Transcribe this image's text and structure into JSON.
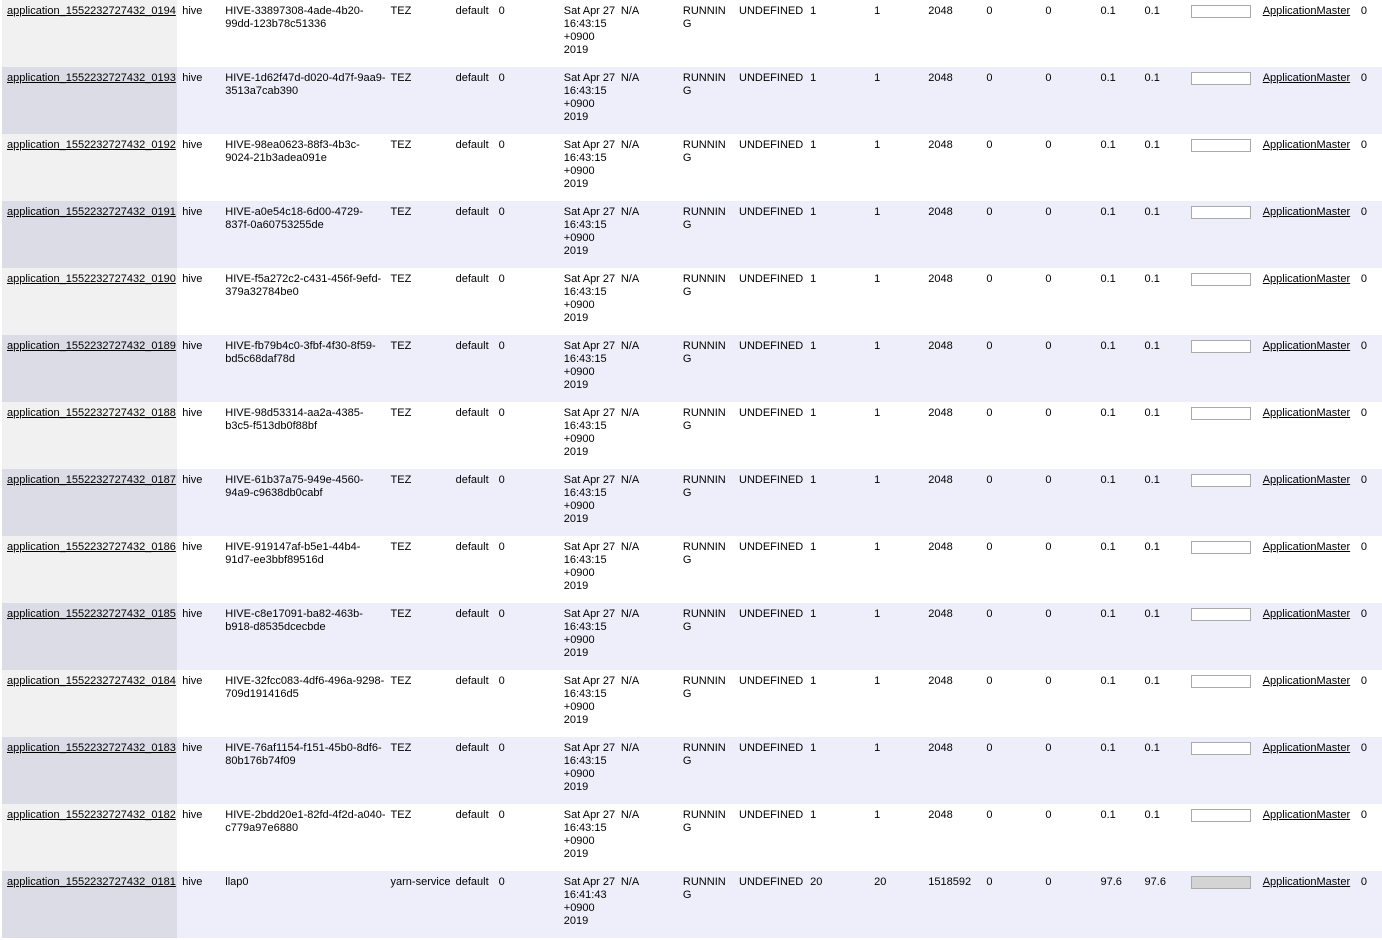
{
  "progress_colors": {
    "fill": "#d4d4d4",
    "border": "#aaaaaa"
  },
  "rows": [
    {
      "id": "application_1552232727432_0194",
      "user": "hive",
      "name": "HIVE-33897308-4ade-4b20-99dd-123b78c51336",
      "type": "TEZ",
      "queue": "default",
      "priority": "0",
      "start": "Sat Apr 27 16:43:15 +0900 2019",
      "finish": "N/A",
      "state": "RUNNING",
      "final_status": "UNDEFINED",
      "containers": "1",
      "vcores": "1",
      "memory": "2048",
      "reserved_cpu": "0",
      "reserved_mem": "0",
      "queue_pct": "0.1",
      "cluster_pct": "0.1",
      "progress": 0,
      "tracking": "ApplicationMaster",
      "blacklisted": "0"
    },
    {
      "id": "application_1552232727432_0193",
      "user": "hive",
      "name": "HIVE-1d62f47d-d020-4d7f-9aa9-3513a7cab390",
      "type": "TEZ",
      "queue": "default",
      "priority": "0",
      "start": "Sat Apr 27 16:43:15 +0900 2019",
      "finish": "N/A",
      "state": "RUNNING",
      "final_status": "UNDEFINED",
      "containers": "1",
      "vcores": "1",
      "memory": "2048",
      "reserved_cpu": "0",
      "reserved_mem": "0",
      "queue_pct": "0.1",
      "cluster_pct": "0.1",
      "progress": 0,
      "tracking": "ApplicationMaster",
      "blacklisted": "0"
    },
    {
      "id": "application_1552232727432_0192",
      "user": "hive",
      "name": "HIVE-98ea0623-88f3-4b3c-9024-21b3adea091e",
      "type": "TEZ",
      "queue": "default",
      "priority": "0",
      "start": "Sat Apr 27 16:43:15 +0900 2019",
      "finish": "N/A",
      "state": "RUNNING",
      "final_status": "UNDEFINED",
      "containers": "1",
      "vcores": "1",
      "memory": "2048",
      "reserved_cpu": "0",
      "reserved_mem": "0",
      "queue_pct": "0.1",
      "cluster_pct": "0.1",
      "progress": 0,
      "tracking": "ApplicationMaster",
      "blacklisted": "0"
    },
    {
      "id": "application_1552232727432_0191",
      "user": "hive",
      "name": "HIVE-a0e54c18-6d00-4729-837f-0a60753255de",
      "type": "TEZ",
      "queue": "default",
      "priority": "0",
      "start": "Sat Apr 27 16:43:15 +0900 2019",
      "finish": "N/A",
      "state": "RUNNING",
      "final_status": "UNDEFINED",
      "containers": "1",
      "vcores": "1",
      "memory": "2048",
      "reserved_cpu": "0",
      "reserved_mem": "0",
      "queue_pct": "0.1",
      "cluster_pct": "0.1",
      "progress": 0,
      "tracking": "ApplicationMaster",
      "blacklisted": "0"
    },
    {
      "id": "application_1552232727432_0190",
      "user": "hive",
      "name": "HIVE-f5a272c2-c431-456f-9efd-379a32784be0",
      "type": "TEZ",
      "queue": "default",
      "priority": "0",
      "start": "Sat Apr 27 16:43:15 +0900 2019",
      "finish": "N/A",
      "state": "RUNNING",
      "final_status": "UNDEFINED",
      "containers": "1",
      "vcores": "1",
      "memory": "2048",
      "reserved_cpu": "0",
      "reserved_mem": "0",
      "queue_pct": "0.1",
      "cluster_pct": "0.1",
      "progress": 0,
      "tracking": "ApplicationMaster",
      "blacklisted": "0"
    },
    {
      "id": "application_1552232727432_0189",
      "user": "hive",
      "name": "HIVE-fb79b4c0-3fbf-4f30-8f59-bd5c68daf78d",
      "type": "TEZ",
      "queue": "default",
      "priority": "0",
      "start": "Sat Apr 27 16:43:15 +0900 2019",
      "finish": "N/A",
      "state": "RUNNING",
      "final_status": "UNDEFINED",
      "containers": "1",
      "vcores": "1",
      "memory": "2048",
      "reserved_cpu": "0",
      "reserved_mem": "0",
      "queue_pct": "0.1",
      "cluster_pct": "0.1",
      "progress": 0,
      "tracking": "ApplicationMaster",
      "blacklisted": "0"
    },
    {
      "id": "application_1552232727432_0188",
      "user": "hive",
      "name": "HIVE-98d53314-aa2a-4385-b3c5-f513db0f88bf",
      "type": "TEZ",
      "queue": "default",
      "priority": "0",
      "start": "Sat Apr 27 16:43:15 +0900 2019",
      "finish": "N/A",
      "state": "RUNNING",
      "final_status": "UNDEFINED",
      "containers": "1",
      "vcores": "1",
      "memory": "2048",
      "reserved_cpu": "0",
      "reserved_mem": "0",
      "queue_pct": "0.1",
      "cluster_pct": "0.1",
      "progress": 0,
      "tracking": "ApplicationMaster",
      "blacklisted": "0"
    },
    {
      "id": "application_1552232727432_0187",
      "user": "hive",
      "name": "HIVE-61b37a75-949e-4560-94a9-c9638db0cabf",
      "type": "TEZ",
      "queue": "default",
      "priority": "0",
      "start": "Sat Apr 27 16:43:15 +0900 2019",
      "finish": "N/A",
      "state": "RUNNING",
      "final_status": "UNDEFINED",
      "containers": "1",
      "vcores": "1",
      "memory": "2048",
      "reserved_cpu": "0",
      "reserved_mem": "0",
      "queue_pct": "0.1",
      "cluster_pct": "0.1",
      "progress": 0,
      "tracking": "ApplicationMaster",
      "blacklisted": "0"
    },
    {
      "id": "application_1552232727432_0186",
      "user": "hive",
      "name": "HIVE-919147af-b5e1-44b4-91d7-ee3bbf89516d",
      "type": "TEZ",
      "queue": "default",
      "priority": "0",
      "start": "Sat Apr 27 16:43:15 +0900 2019",
      "finish": "N/A",
      "state": "RUNNING",
      "final_status": "UNDEFINED",
      "containers": "1",
      "vcores": "1",
      "memory": "2048",
      "reserved_cpu": "0",
      "reserved_mem": "0",
      "queue_pct": "0.1",
      "cluster_pct": "0.1",
      "progress": 0,
      "tracking": "ApplicationMaster",
      "blacklisted": "0"
    },
    {
      "id": "application_1552232727432_0185",
      "user": "hive",
      "name": "HIVE-c8e17091-ba82-463b-b918-d8535dcecbde",
      "type": "TEZ",
      "queue": "default",
      "priority": "0",
      "start": "Sat Apr 27 16:43:15 +0900 2019",
      "finish": "N/A",
      "state": "RUNNING",
      "final_status": "UNDEFINED",
      "containers": "1",
      "vcores": "1",
      "memory": "2048",
      "reserved_cpu": "0",
      "reserved_mem": "0",
      "queue_pct": "0.1",
      "cluster_pct": "0.1",
      "progress": 0,
      "tracking": "ApplicationMaster",
      "blacklisted": "0"
    },
    {
      "id": "application_1552232727432_0184",
      "user": "hive",
      "name": "HIVE-32fcc083-4df6-496a-9298-709d191416d5",
      "type": "TEZ",
      "queue": "default",
      "priority": "0",
      "start": "Sat Apr 27 16:43:15 +0900 2019",
      "finish": "N/A",
      "state": "RUNNING",
      "final_status": "UNDEFINED",
      "containers": "1",
      "vcores": "1",
      "memory": "2048",
      "reserved_cpu": "0",
      "reserved_mem": "0",
      "queue_pct": "0.1",
      "cluster_pct": "0.1",
      "progress": 0,
      "tracking": "ApplicationMaster",
      "blacklisted": "0"
    },
    {
      "id": "application_1552232727432_0183",
      "user": "hive",
      "name": "HIVE-76af1154-f151-45b0-8df6-80b176b74f09",
      "type": "TEZ",
      "queue": "default",
      "priority": "0",
      "start": "Sat Apr 27 16:43:15 +0900 2019",
      "finish": "N/A",
      "state": "RUNNING",
      "final_status": "UNDEFINED",
      "containers": "1",
      "vcores": "1",
      "memory": "2048",
      "reserved_cpu": "0",
      "reserved_mem": "0",
      "queue_pct": "0.1",
      "cluster_pct": "0.1",
      "progress": 0,
      "tracking": "ApplicationMaster",
      "blacklisted": "0"
    },
    {
      "id": "application_1552232727432_0182",
      "user": "hive",
      "name": "HIVE-2bdd20e1-82fd-4f2d-a040-c779a97e6880",
      "type": "TEZ",
      "queue": "default",
      "priority": "0",
      "start": "Sat Apr 27 16:43:15 +0900 2019",
      "finish": "N/A",
      "state": "RUNNING",
      "final_status": "UNDEFINED",
      "containers": "1",
      "vcores": "1",
      "memory": "2048",
      "reserved_cpu": "0",
      "reserved_mem": "0",
      "queue_pct": "0.1",
      "cluster_pct": "0.1",
      "progress": 0,
      "tracking": "ApplicationMaster",
      "blacklisted": "0"
    },
    {
      "id": "application_1552232727432_0181",
      "user": "hive",
      "name": "llap0",
      "type": "yarn-service",
      "queue": "default",
      "priority": "0",
      "start": "Sat Apr 27 16:41:43 +0900 2019",
      "finish": "N/A",
      "state": "RUNNING",
      "final_status": "UNDEFINED",
      "containers": "20",
      "vcores": "20",
      "memory": "1518592",
      "reserved_cpu": "0",
      "reserved_mem": "0",
      "queue_pct": "97.6",
      "cluster_pct": "97.6",
      "progress": 1,
      "tracking": "ApplicationMaster",
      "blacklisted": "0"
    }
  ]
}
